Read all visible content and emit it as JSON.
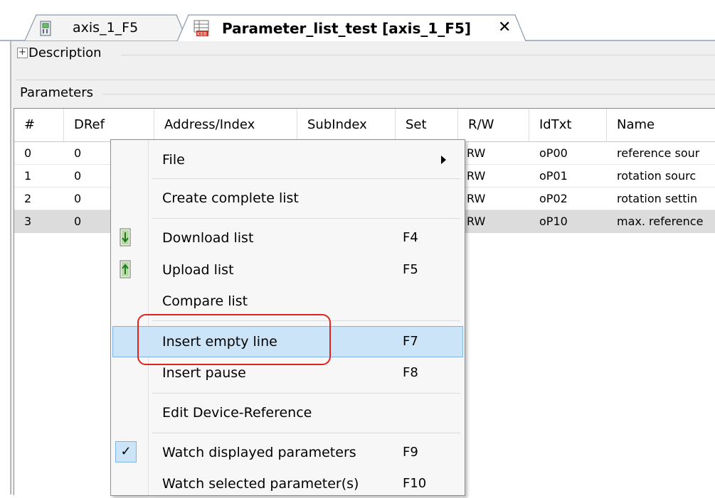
{
  "tabs": [
    {
      "label": "axis_1_F5",
      "active": false,
      "icon": "device-icon"
    },
    {
      "label": "Parameter_list_test [axis_1_F5]",
      "active": true,
      "icon": "parameter-list-icon",
      "close": "✕"
    }
  ],
  "description": {
    "expander": "+",
    "label": "Description"
  },
  "parameters": {
    "label": "Parameters",
    "columns": [
      "#",
      "DRef",
      "Address/Index",
      "SubIndex",
      "Set",
      "R/W",
      "IdTxt",
      "Name"
    ],
    "rows": [
      {
        "num": "0",
        "dref": "0",
        "rw": "RW",
        "idtxt": "oP00",
        "name": "reference sour"
      },
      {
        "num": "1",
        "dref": "0",
        "rw": "RW",
        "idtxt": "oP01",
        "name": "rotation sourc"
      },
      {
        "num": "2",
        "dref": "0",
        "rw": "RW",
        "idtxt": "oP02",
        "name": "rotation settin"
      },
      {
        "num": "3",
        "dref": "0",
        "rw": "RW",
        "idtxt": "oP10",
        "name": "max. reference"
      }
    ],
    "selected_row": 3
  },
  "context_menu": {
    "items": [
      {
        "label": "File",
        "key": "",
        "submenu": true
      },
      {
        "label": "Create complete list",
        "key": ""
      },
      {
        "label": "Download list",
        "key": "F4",
        "icon": "download-icon"
      },
      {
        "label": "Upload list",
        "key": "F5",
        "icon": "upload-icon"
      },
      {
        "label": "Compare list",
        "key": ""
      },
      {
        "label": "Insert empty line",
        "key": "F7",
        "highlighted": true
      },
      {
        "label": "Insert pause",
        "key": "F8"
      },
      {
        "label": "Edit Device-Reference",
        "key": ""
      },
      {
        "label": "Watch displayed parameters",
        "key": "F9",
        "checked": true,
        "check_mark": "✓"
      },
      {
        "label": "Watch selected parameter(s)",
        "key": "F10"
      }
    ]
  },
  "colors": {
    "highlight": "#cce4f7",
    "highlight_border": "#7eb4ea",
    "annotation_red": "#e0241d",
    "selected_row": "#dcdcdc"
  }
}
